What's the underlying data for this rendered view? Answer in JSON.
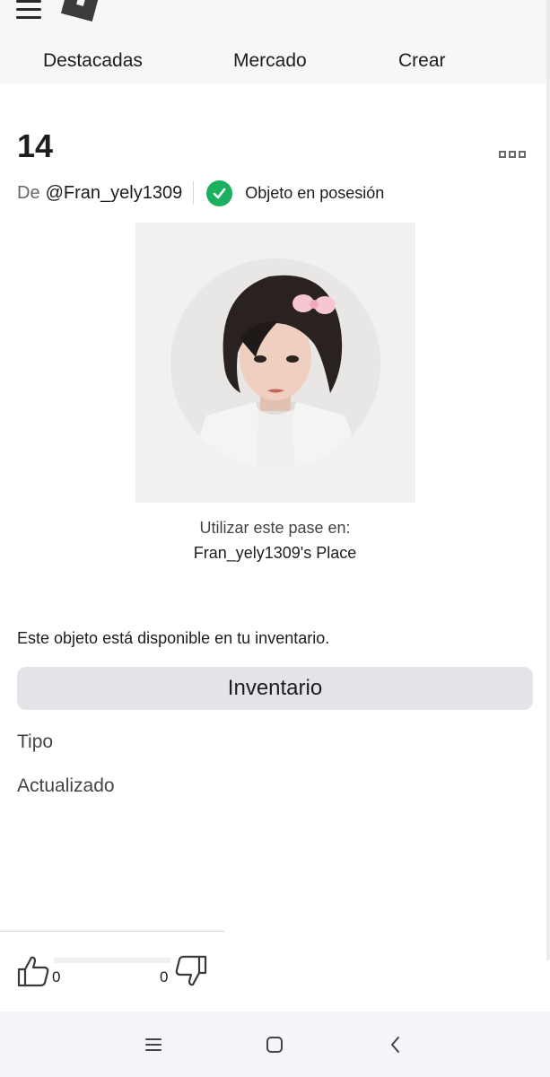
{
  "header": {
    "nav": [
      "Destacadas",
      "Mercado",
      "Crear"
    ]
  },
  "item": {
    "title": "14",
    "creator_prefix": "De",
    "creator": "@Fran_yely1309",
    "owned_label": "Objeto en posesión",
    "use_label": "Utilizar este pase en:",
    "place_name": "Fran_yely1309's Place",
    "availability": "Este objeto está disponible en tu inventario.",
    "inventory_button": "Inventario",
    "type_label": "Tipo",
    "updated_label": "Actualizado"
  },
  "votes": {
    "up": "0",
    "down": "0"
  },
  "colors": {
    "accent_check": "#1ab05f",
    "button_bg": "#e3e4e8",
    "header_bg": "#f7f7f8"
  },
  "icons": [
    "hamburger-menu-icon",
    "roblox-logo-icon",
    "more-options-icon",
    "check-circle-icon",
    "thumbs-up-icon",
    "thumbs-down-icon",
    "recents-icon",
    "home-icon",
    "back-icon"
  ]
}
